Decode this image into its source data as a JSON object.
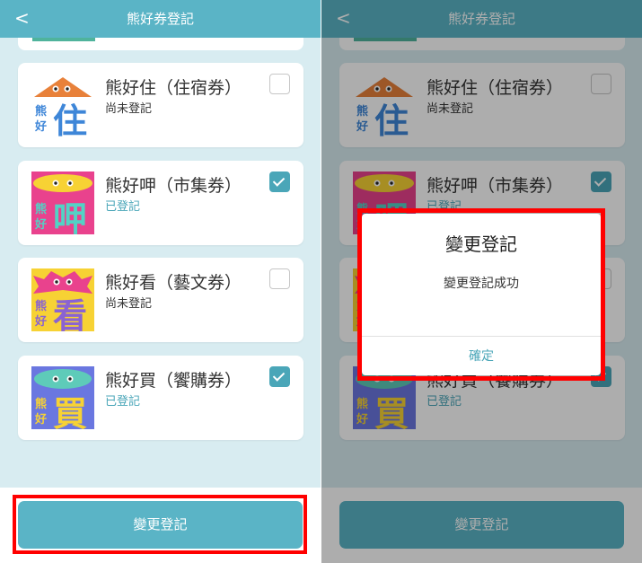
{
  "header": {
    "title": "熊好券登記",
    "back_icon": "chevron-left-icon",
    "back_glyph": "<"
  },
  "vouchers": [
    {
      "name": "熊好住（住宿券）",
      "status": "尚未登記",
      "checked": false,
      "logo_char": "住",
      "logo_top_color": "#e8813a",
      "logo_bg": "#ffffff",
      "logo_char_color": "#3e86d8"
    },
    {
      "name": "熊好呷（市集券）",
      "status": "已登記",
      "checked": true,
      "logo_char": "呷",
      "logo_top_color": "#f7d234",
      "logo_bg": "#e9428d",
      "logo_char_color": "#53d2c5"
    },
    {
      "name": "熊好看（藝文券）",
      "status": "尚未登記",
      "checked": false,
      "logo_char": "看",
      "logo_top_color": "#e9428d",
      "logo_bg": "#f7d234",
      "logo_char_color": "#8a63d2"
    },
    {
      "name": "熊好買（饗購券）",
      "status": "已登記",
      "checked": true,
      "logo_char": "買",
      "logo_top_color": "#5ecbb9",
      "logo_bg": "#6a77e0",
      "logo_char_color": "#f7d234"
    }
  ],
  "logo_small_text": [
    "熊",
    "好"
  ],
  "submit_label": "變更登記",
  "dialog": {
    "title": "變更登記",
    "message": "變更登記成功",
    "confirm_label": "確定"
  },
  "colors": {
    "accent": "#5ab4c6",
    "highlight": "#ff0000",
    "checked": "#4aa6b8"
  }
}
